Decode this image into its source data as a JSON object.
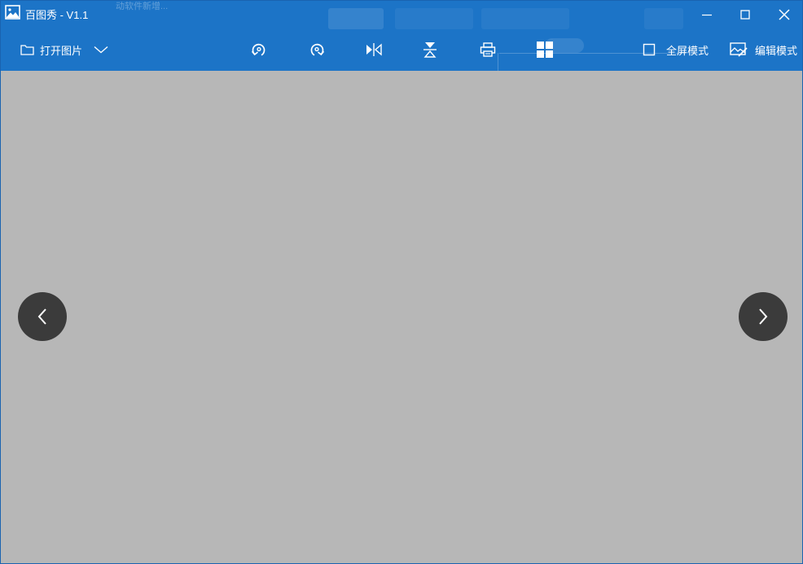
{
  "window": {
    "title": "百图秀 - V1.1",
    "background_fragment": "动软件新增..."
  },
  "colors": {
    "header": "#1c74c7",
    "viewer_bg": "#b7b7b7",
    "nav_button": "#3b3b3b",
    "icon": "#ffffff"
  },
  "toolbar": {
    "open_image": "打开图片",
    "fullscreen_mode": "全屏模式",
    "edit_mode": "编辑模式"
  },
  "icons": {
    "app": "image-icon",
    "minimize": "minimize-icon",
    "maximize": "maximize-icon",
    "close": "close-icon",
    "open": "folder-icon",
    "dropdown": "chevron-down-icon",
    "rotate_left": "rotate-left-icon",
    "rotate_right": "rotate-right-icon",
    "flip_horizontal": "flip-horizontal-icon",
    "flip_vertical": "flip-vertical-icon",
    "print": "printer-icon",
    "grid": "grid-icon",
    "fullscreen": "checkbox-icon",
    "edit": "edit-image-icon",
    "prev": "chevron-left-icon",
    "next": "chevron-right-icon"
  }
}
